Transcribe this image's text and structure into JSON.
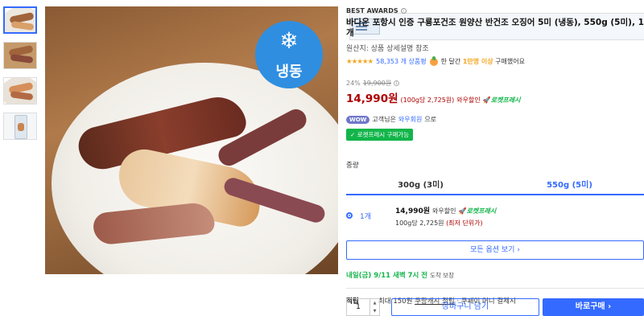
{
  "badge": {
    "frozen_label": "냉동",
    "frozen_icon": "snowflake-icon"
  },
  "product": {
    "awards": "BEST AWARDS",
    "title": "바다온 포항시 인증 구룡포건조 원양산 반건조 오징어 5미 (냉동), 550g (5미), 1개",
    "origin": "원산지: 상품 상세설명 참조",
    "rating": 4.5,
    "stars": "★★★★★",
    "review_count": "58,353 개 상품평",
    "buy_count_prefix": "한 달간",
    "buy_count_highlight": "1만명 이상",
    "buy_count_suffix": "구매했어요"
  },
  "price": {
    "discount": "24%",
    "original": "19,900원",
    "sale": "14,990원",
    "unit": "(100g당 2,725원)",
    "wow_sale": "와우할인",
    "rocket_fresh": "로켓프레시"
  },
  "wow": {
    "badge": "WOW",
    "text_prefix": "고객님은",
    "text_link": "와우회원",
    "text_suffix": "으로",
    "fresh_badge": "✓ 로켓프레시 구매가능"
  },
  "options": {
    "weight_label": "중량",
    "tabs": [
      {
        "label": "300g (3미)",
        "active": false
      },
      {
        "label": "550g (5미)",
        "active": true
      }
    ],
    "selected": {
      "qty": "1개",
      "price": "14,990원",
      "wow_sale": "와우할인",
      "rocket_fresh": "로켓프레시",
      "unit_prefix": "100g당 2,725원",
      "unit_red": "(최저 단위가)"
    },
    "all_options": "모든 옵션 보기 ›"
  },
  "delivery": {
    "text": "내일(금) 9/11 새벽 7시 전",
    "note": "도착 보장"
  },
  "cash": {
    "label": "적립",
    "prefix": "최대 150원",
    "link": "쿠팡캐시 적립",
    "suffix": "· 쿠페이 머니 결제시"
  },
  "purchase": {
    "quantity": "1",
    "cart_label": "장바구니 담기",
    "buy_label": "바로구매 ›"
  },
  "colors": {
    "accent": "#346aff",
    "price_red": "#ae0000",
    "rocket_green": "#12b54a",
    "star": "#f5a623",
    "frozen_badge": "#2f8ee0"
  }
}
